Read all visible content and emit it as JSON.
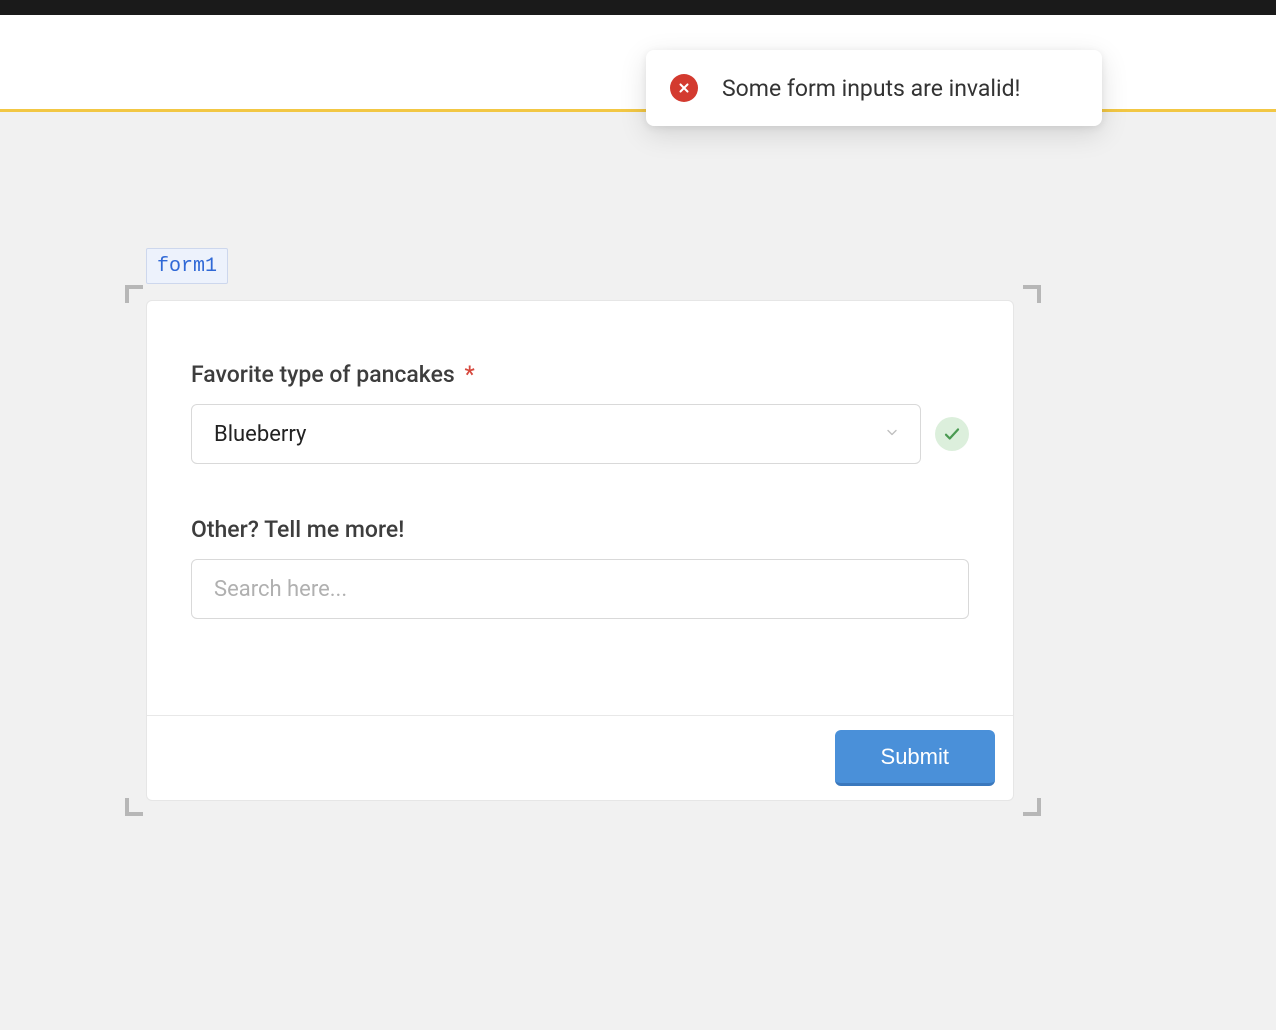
{
  "toast": {
    "message": "Some form inputs are invalid!"
  },
  "form": {
    "badge": "form1",
    "fields": {
      "pancakes": {
        "label": "Favorite type of pancakes",
        "required_mark": "*",
        "value": "Blueberry",
        "valid": true
      },
      "other": {
        "label": "Other? Tell me more!",
        "placeholder": "Search here...",
        "value": ""
      }
    },
    "submit_label": "Submit"
  }
}
